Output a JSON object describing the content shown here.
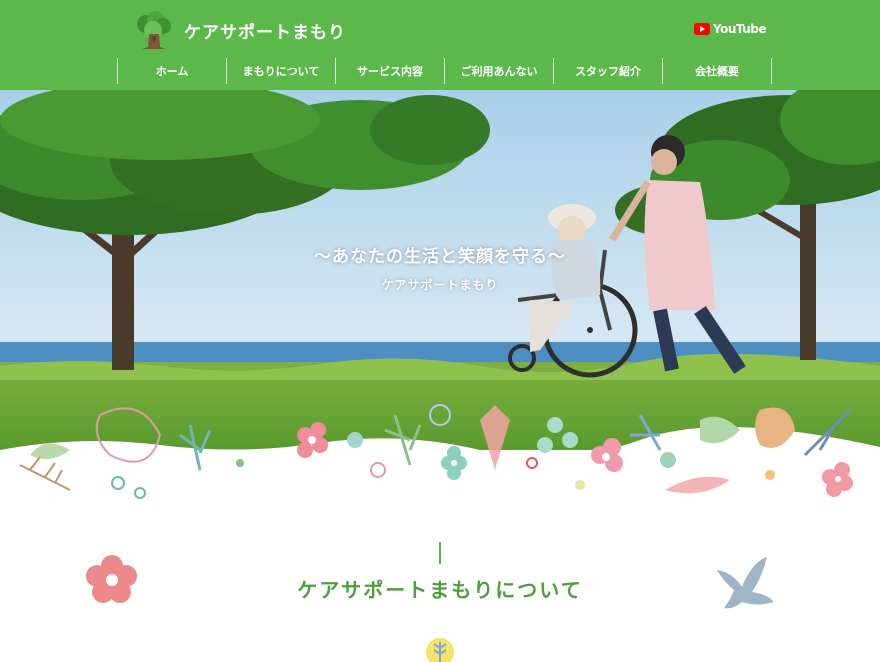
{
  "header": {
    "site_title": "ケアサポートまもり",
    "youtube_label": "YouTube",
    "brand_color": "#5db84b"
  },
  "nav": {
    "items": [
      "ホーム",
      "まもりについて",
      "サービス内容",
      "ご利用あんない",
      "スタッフ紹介",
      "会社概要"
    ]
  },
  "hero": {
    "catch": "〜あなたの生活と笑顔を守る〜",
    "name": "ケアサポートまもり"
  },
  "about": {
    "title": "ケアサポートまもりについて"
  },
  "icons": {
    "logo": "tree-logo-icon",
    "youtube": "youtube-icon",
    "left_deco": "flower-icon",
    "right_deco": "bird-icon",
    "bottom_deco": "leaf-circle-icon"
  }
}
